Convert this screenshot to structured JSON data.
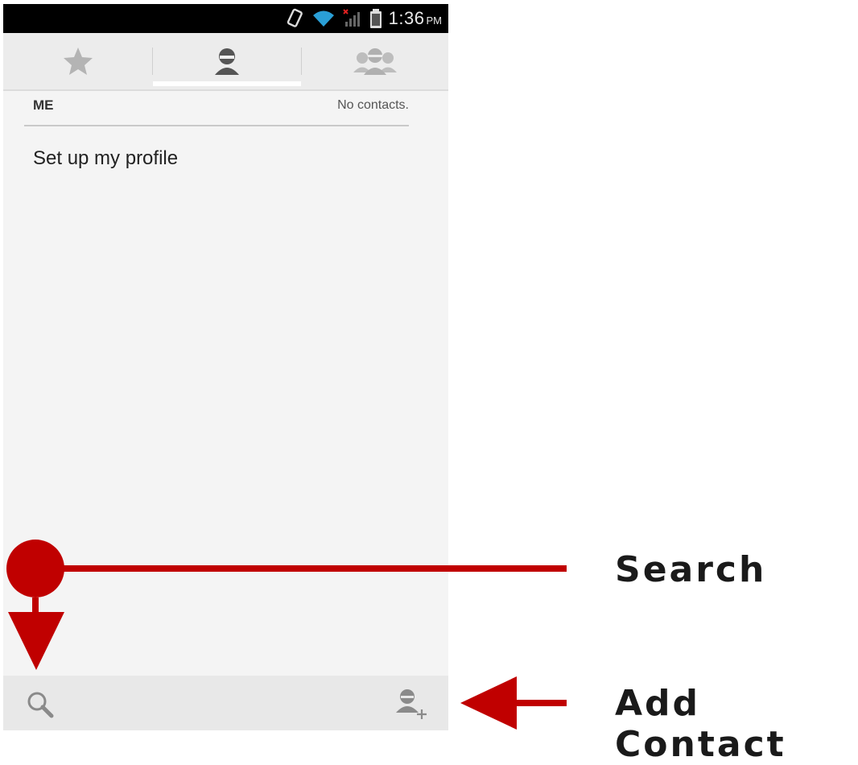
{
  "status_bar": {
    "time": "1:36",
    "ampm": "PM"
  },
  "tabs": [
    {
      "name": "favorites",
      "icon": "star-icon"
    },
    {
      "name": "contacts",
      "icon": "person-icon",
      "selected": true
    },
    {
      "name": "groups",
      "icon": "group-icon"
    }
  ],
  "section": {
    "title": "ME",
    "count_text": "No contacts."
  },
  "profile": {
    "label": "Set up my profile"
  },
  "bottom_bar": {
    "left_icon": "search-icon",
    "right_icon": "add-contact-icon"
  },
  "annotations": {
    "search": "Search",
    "add_contact": "Add Contact",
    "color": "#c00000"
  }
}
